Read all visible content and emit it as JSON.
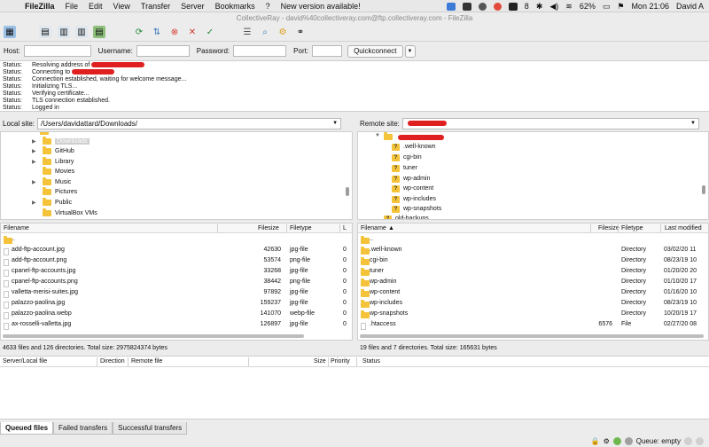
{
  "menubar": {
    "app_name": "FileZilla",
    "items": [
      "File",
      "Edit",
      "View",
      "Transfer",
      "Server",
      "Bookmarks",
      "?",
      "New version available!"
    ],
    "battery": "62%",
    "clock": "Mon 21:06",
    "user": "David A",
    "notification_count": "8"
  },
  "window": {
    "title": "CollectiveRay - david%40collectiveray.com@ftp.collectiveray.com - FileZilla"
  },
  "quickconnect": {
    "host_label": "Host:",
    "username_label": "Username:",
    "password_label": "Password:",
    "port_label": "Port:",
    "button_label": "Quickconnect",
    "dropdown_glyph": "▼"
  },
  "status_log": {
    "label": "Status:",
    "messages": [
      "Resolving address of",
      "Connecting to",
      "Connection established, waiting for welcome message...",
      "Initializing TLS...",
      "Verifying certificate...",
      "TLS connection established.",
      "Logged in"
    ]
  },
  "local": {
    "site_label": "Local site:",
    "path": "/Users/davidattard/Downloads/",
    "tree": [
      {
        "name": "Downloads",
        "selected": true,
        "arrow": true
      },
      {
        "name": "GitHub",
        "arrow": true
      },
      {
        "name": "Library",
        "arrow": true
      },
      {
        "name": "Movies",
        "arrow": false
      },
      {
        "name": "Music",
        "arrow": true
      },
      {
        "name": "Pictures",
        "arrow": false
      },
      {
        "name": "Public",
        "arrow": true
      },
      {
        "name": "VirtualBox VMs",
        "arrow": false
      }
    ],
    "columns": [
      "Filename",
      "Filesize",
      "Filetype",
      "L"
    ],
    "files": [
      {
        "name": "..",
        "size": "",
        "type": "",
        "l": "",
        "folder": true
      },
      {
        "name": "add-ftp-account.jpg",
        "size": "42630",
        "type": "jpg-file",
        "l": "0"
      },
      {
        "name": "add-ftp-account.png",
        "size": "53574",
        "type": "png-file",
        "l": "0"
      },
      {
        "name": "cpanel-ftp-accounts.jpg",
        "size": "33268",
        "type": "jpg-file",
        "l": "0"
      },
      {
        "name": "cpanel-ftp-accounts.png",
        "size": "38442",
        "type": "png-file",
        "l": "0"
      },
      {
        "name": "valletta-merisi-suites.jpg",
        "size": "97892",
        "type": "jpg-file",
        "l": "0"
      },
      {
        "name": "palazzo-paolina.jpg",
        "size": "159237",
        "type": "jpg-file",
        "l": "0"
      },
      {
        "name": "palazzo-paolina.webp",
        "size": "141070",
        "type": "webp-file",
        "l": "0"
      },
      {
        "name": "ax-rosselli-valletta.jpg",
        "size": "126897",
        "type": "jpg-file",
        "l": "0"
      }
    ],
    "summary": "4633 files and 126 directories. Total size: 2975824374 bytes"
  },
  "remote": {
    "site_label": "Remote site:",
    "tree": [
      {
        "name": ".well-known"
      },
      {
        "name": "cgi-bin"
      },
      {
        "name": "tuner"
      },
      {
        "name": "wp-admin"
      },
      {
        "name": "wp-content"
      },
      {
        "name": "wp-includes"
      },
      {
        "name": "wp-snapshots"
      }
    ],
    "tree_bottom": "old-backups",
    "columns": [
      "Filename",
      "Filesize",
      "Filetype",
      "Last modified"
    ],
    "files": [
      {
        "name": "..",
        "size": "",
        "type": "",
        "modified": ""
      },
      {
        "name": ".well-known",
        "size": "",
        "type": "Directory",
        "modified": "03/02/20 11"
      },
      {
        "name": "cgi-bin",
        "size": "",
        "type": "Directory",
        "modified": "08/23/19 10"
      },
      {
        "name": "tuner",
        "size": "",
        "type": "Directory",
        "modified": "01/20/20 20"
      },
      {
        "name": "wp-admin",
        "size": "",
        "type": "Directory",
        "modified": "01/10/20 17"
      },
      {
        "name": "wp-content",
        "size": "",
        "type": "Directory",
        "modified": "01/16/20 10"
      },
      {
        "name": "wp-includes",
        "size": "",
        "type": "Directory",
        "modified": "08/23/19 10"
      },
      {
        "name": "wp-snapshots",
        "size": "",
        "type": "Directory",
        "modified": "10/20/19 17"
      },
      {
        "name": ".htaccess",
        "size": "6576",
        "type": "File",
        "modified": "02/27/20 08"
      }
    ],
    "summary": "19 files and 7 directories. Total size: 165631 bytes"
  },
  "queue": {
    "columns": [
      "Server/Local file",
      "Direction",
      "Remote file",
      "Size",
      "Priority",
      "Status"
    ],
    "tabs": [
      "Queued files",
      "Failed transfers",
      "Successful transfers"
    ],
    "status_text": "Queue: empty"
  },
  "colors": {
    "folder": "#f4c33a",
    "redaction": "#e02020"
  }
}
